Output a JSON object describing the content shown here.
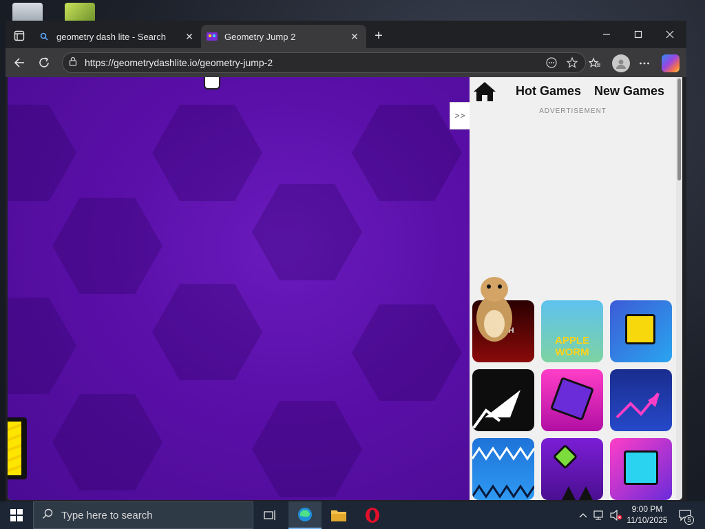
{
  "browser": {
    "tabs": [
      {
        "title": "geometry dash lite - Search",
        "active": false
      },
      {
        "title": "Geometry Jump 2",
        "active": true
      }
    ],
    "url": "https://geometrydashlite.io/geometry-jump-2"
  },
  "page": {
    "nav": {
      "hot_games": "Hot Games",
      "new_games": "New Games"
    },
    "sidebar_toggle": ">>",
    "ad_label": "ADVERTISEMENT",
    "game_thumbs": [
      {
        "label": "DASH"
      },
      {
        "label": "APPLE WORM"
      },
      {
        "label": ""
      },
      {
        "label": ""
      },
      {
        "label": ""
      },
      {
        "label": ""
      },
      {
        "label": ""
      },
      {
        "label": ""
      },
      {
        "label": ""
      }
    ]
  },
  "taskbar": {
    "search_placeholder": "Type here to search",
    "time": "9:00 PM",
    "date": "11/10/2025",
    "notification_count": "5"
  },
  "colors": {
    "game_bg": "#5a0fa8",
    "sidebar_bg": "#f0f0f0",
    "taskbar_bg": "#1c2634",
    "browser_chrome": "#202124"
  }
}
